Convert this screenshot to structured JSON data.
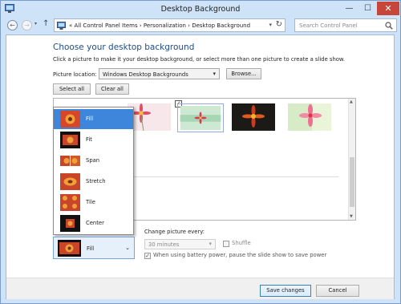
{
  "window": {
    "title": "Desktop Background",
    "minimize_glyph": "—",
    "maximize_glyph": "☐",
    "close_glyph": "✕"
  },
  "nav": {
    "back_glyph": "←",
    "forward_glyph": "→",
    "recent_glyph": "▾",
    "up_glyph": "↑",
    "address": "« All Control Panel Items  ›  Personalization  ›  Desktop Background",
    "address_dropdown_glyph": "▾",
    "refresh_glyph": "↻",
    "search_placeholder": "Search Control Panel"
  },
  "main": {
    "heading": "Choose your desktop background",
    "subtext": "Click a picture to make it your desktop background, or select more than one picture to create a slide show.",
    "picture_location_label": "Picture location:",
    "picture_location_value": "Windows Desktop Backgrounds",
    "select_arrow": "▾",
    "browse_label": "Browse...",
    "select_all_label": "Select all",
    "clear_all_label": "Clear all",
    "check_mark": "✓"
  },
  "gallery": {
    "thumbnails": [
      "flower-pink",
      "flower-green",
      "flower-red-dark",
      "flower-soft-pink"
    ],
    "scroll_up": "▲",
    "scroll_down": "▼"
  },
  "picture_position": {
    "options": [
      "Fill",
      "Fit",
      "Span",
      "Stretch",
      "Tile",
      "Center"
    ],
    "selected": "Fill",
    "arrow": "⌄"
  },
  "slideshow": {
    "change_label": "Change picture every:",
    "interval": "30 minutes",
    "interval_arrow": "▾",
    "shuffle_label": "Shuffle",
    "shuffle_checked": false,
    "battery_label": "When using battery power, pause the slide show to save power",
    "battery_checked": true,
    "battery_check_mark": "✓"
  },
  "footer": {
    "save_label": "Save changes",
    "cancel_label": "Cancel"
  },
  "colors": {
    "accent": "#3e86dc",
    "heading": "#1c4d8e",
    "close": "#c7463a"
  }
}
